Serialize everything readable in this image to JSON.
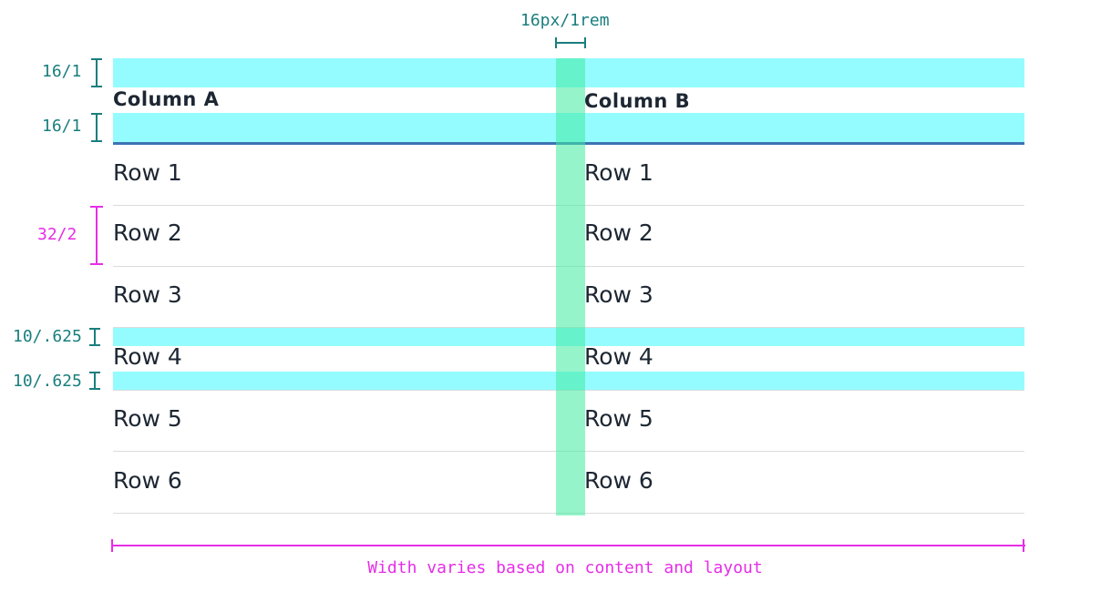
{
  "spacing": {
    "gutter_label": "16px/1rem",
    "header_top_label": "16/1",
    "header_bottom_label": "16/1",
    "row_height_label": "32/2",
    "row_padding_top_label": "10/.625",
    "row_padding_bottom_label": "10/.625",
    "width_label": "Width varies based on content and layout"
  },
  "table": {
    "columns": [
      "Column A",
      "Column B"
    ],
    "rows": [
      [
        "Row 1",
        "Row 1"
      ],
      [
        "Row 2",
        "Row 2"
      ],
      [
        "Row 3",
        "Row 3"
      ],
      [
        "Row 4",
        "Row 4"
      ],
      [
        "Row 5",
        "Row 5"
      ],
      [
        "Row 6",
        "Row 6"
      ]
    ]
  },
  "colors": {
    "padding_band": "#3dfaff",
    "gutter_band": "#40eba0",
    "spec_teal": "#1a7e7e",
    "spec_pink": "#e62ee6",
    "header_rule": "#3d72b4",
    "text": "#1d2733"
  }
}
